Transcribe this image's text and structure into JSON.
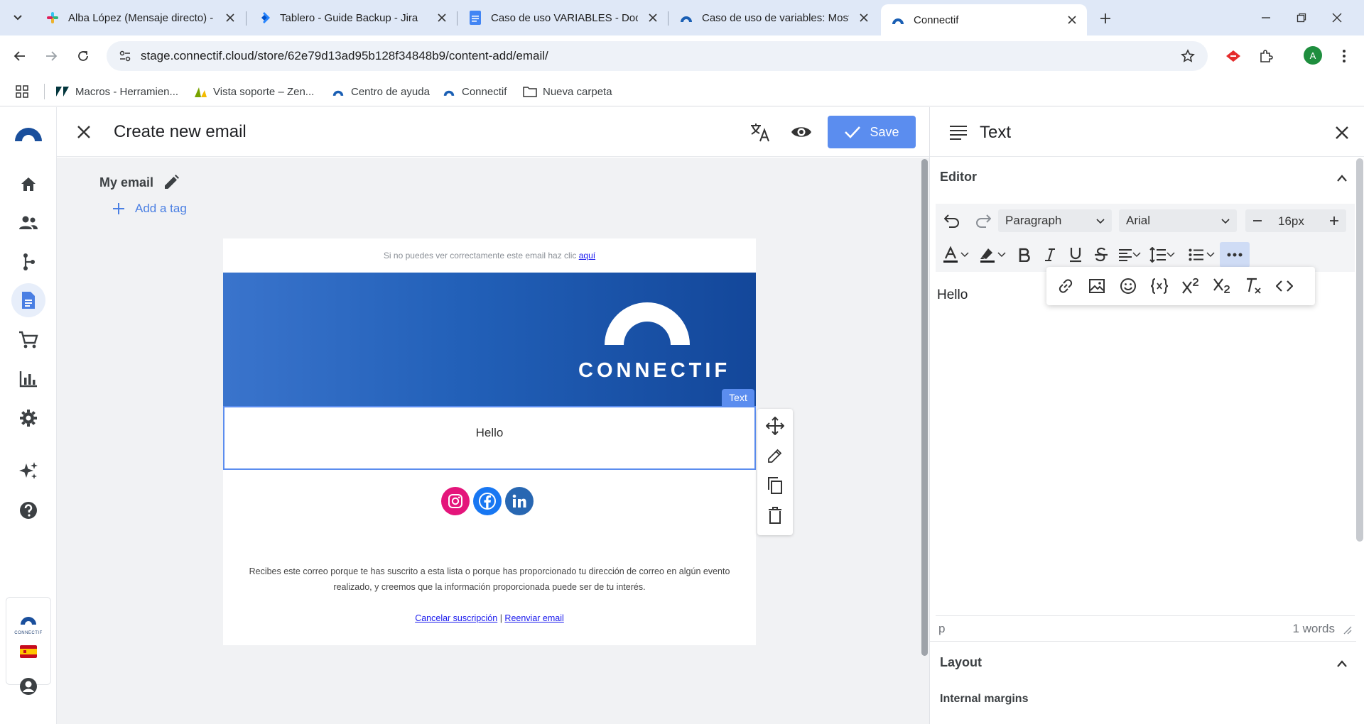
{
  "browser": {
    "tabs": [
      {
        "title": "Alba López (Mensaje directo) - C",
        "favicon": "slack-icon"
      },
      {
        "title": "Tablero - Guide Backup - Jira",
        "favicon": "jira-icon"
      },
      {
        "title": "Caso de uso VARIABLES - Docu",
        "favicon": "docs-icon"
      },
      {
        "title": "Caso de uso de variables: Most",
        "favicon": "connectif-icon"
      },
      {
        "title": "Connectif",
        "favicon": "connectif-icon",
        "active": true
      }
    ],
    "url": "stage.connectif.cloud/store/62e79d13ad95b128f34848b9/content-add/email/",
    "profile_initial": "A",
    "bookmarks": [
      {
        "label": "Macros - Herramien...",
        "icon": "zendesk-icon"
      },
      {
        "label": "Vista soporte – Zen...",
        "icon": "zendesk-support-icon"
      },
      {
        "label": "Centro de ayuda",
        "icon": "connectif-icon"
      },
      {
        "label": "Connectif",
        "icon": "connectif-icon"
      },
      {
        "label": "Nueva carpeta",
        "icon": "folder-icon"
      }
    ]
  },
  "app": {
    "brand_color": "#1a4f9c",
    "accent_color": "#5b8def",
    "sidebar": [
      {
        "name": "home-icon"
      },
      {
        "name": "contacts-icon"
      },
      {
        "name": "workflows-icon"
      },
      {
        "name": "content-icon",
        "active": true
      },
      {
        "name": "store-icon"
      },
      {
        "name": "reports-icon"
      },
      {
        "name": "settings-icon"
      },
      {
        "name": "ai-sparkle-icon"
      },
      {
        "name": "help-icon"
      }
    ],
    "store_brand": "CONNECTIF",
    "header": {
      "title": "Create new email",
      "save_label": "Save"
    },
    "email_name": "My email",
    "add_tag_label": "Add a tag",
    "email": {
      "preheader_text": "Si no puedes ver correctamente este email haz clic ",
      "preheader_link": "aquí",
      "banner_wordmark": "CONNECTIF",
      "selected_block_tag": "Text",
      "body_text": "Hello",
      "social": [
        "instagram",
        "facebook",
        "linkedin"
      ],
      "footer_text": "Recibes este correo porque te has suscrito a esta lista o porque has proporcionado tu dirección de correo en algún evento realizado, y creemos que la información proporcionada puede ser de tu interés.",
      "footer_link_unsubscribe": "Cancelar suscripción",
      "footer_separator": " | ",
      "footer_link_forward": "Reenviar email"
    }
  },
  "panel": {
    "title": "Text",
    "editor_section": "Editor",
    "block_format": "Paragraph",
    "font_family": "Arial",
    "font_size": "16px",
    "content": "Hello",
    "status_path": "p",
    "word_count": "1 words",
    "layout_section": "Layout",
    "internal_margins_label": "Internal margins"
  }
}
